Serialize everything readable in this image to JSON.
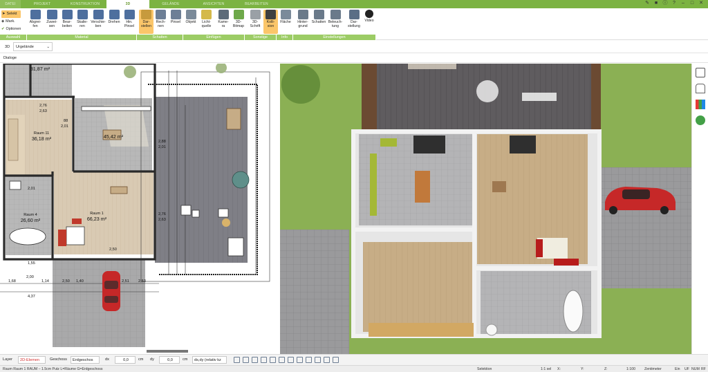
{
  "tabs": [
    "DATEI",
    "PROJEKT",
    "KONSTRUKTION",
    "3D",
    "GELÄNDE",
    "ANSICHTEN",
    "BEARBEITEN"
  ],
  "active_tab": "3D",
  "selection": {
    "select": "Selekt",
    "mark": "Mark.",
    "options": "Optionen"
  },
  "ribbon": {
    "groups": [
      "Auswahl",
      "Material",
      "Schatten",
      "Einfügen",
      "Sonstige",
      "Info",
      "Einstellungen"
    ],
    "buttons": [
      {
        "label1": "Abgrei-",
        "label2": "fen"
      },
      {
        "label1": "Zuwei-",
        "label2": "sen"
      },
      {
        "label1": "Bear-",
        "label2": "beiten"
      },
      {
        "label1": "Skalie-",
        "label2": "ren"
      },
      {
        "label1": "Verschie-",
        "label2": "ben"
      },
      {
        "label1": "Drehen",
        "label2": ""
      },
      {
        "label1": "Hin.",
        "label2": "Pinsel"
      },
      {
        "label1": "Dar-",
        "label2": "stellen"
      },
      {
        "label1": "Rech-",
        "label2": "nen"
      },
      {
        "label1": "Pinsel",
        "label2": ""
      },
      {
        "label1": "Objekt",
        "label2": ""
      },
      {
        "label1": "Licht-",
        "label2": "quelle"
      },
      {
        "label1": "Kame-",
        "label2": "ra"
      },
      {
        "label1": "3D-",
        "label2": "Bitmap"
      },
      {
        "label1": "3D-",
        "label2": "Schrift"
      },
      {
        "label1": "Kolli-",
        "label2": "sion"
      },
      {
        "label1": "Fläche",
        "label2": ""
      },
      {
        "label1": "Hinter-",
        "label2": "grund"
      },
      {
        "label1": "Schatten",
        "label2": ""
      },
      {
        "label1": "Beleuch-",
        "label2": "tung"
      },
      {
        "label1": "Dar-",
        "label2": "stellung"
      },
      {
        "label1": "Video",
        "label2": ""
      }
    ]
  },
  "view": {
    "label": "3D",
    "dropdown": "Urgelände"
  },
  "dialog": "Dialoge",
  "rooms": [
    {
      "area": "31,87 m²"
    },
    {
      "name": "Raum 11",
      "area": "36,18 m²"
    },
    {
      "name": "",
      "area": "45,42 m²"
    },
    {
      "name": "Raum 1",
      "area": "66,23 m²"
    },
    {
      "name": "Raum 4",
      "area": "26,60 m²"
    }
  ],
  "dims": [
    "88",
    "2,01",
    "2,88",
    "2,01",
    "2,76",
    "2,63",
    "2,76",
    "2,63",
    "2,01",
    "1,55",
    "2,50",
    "2,00",
    "4,37",
    "2,50",
    "1,68",
    "1,14",
    "1,40",
    "2,51",
    "2,53"
  ],
  "statusbar": {
    "layer_label": "Layer",
    "layer_value": "2D-Elemen",
    "geschoss_label": "Geschoss",
    "geschoss_value": "Erdgeschos",
    "dx_label": "dx",
    "dx_value": "0,0",
    "dy_label": "dy",
    "dy_value": "0,0",
    "unit1": "cm",
    "unit2": "cm",
    "mode": "ds,dy (relativ kz"
  },
  "footer": {
    "left": "Raum Raum 1 RAUM – 1.5cm Putz L=Räume G=Erdgeschoss",
    "selektion": "Selektion",
    "ratio": "1:1 sel",
    "x": "X:",
    "y": "Y:",
    "z": "Z:",
    "scale": "1:100",
    "unit": "Zentimeter",
    "ein": "Ein",
    "uf": "UF",
    "num": "NUM",
    "rf": "RF"
  },
  "colors": {
    "green": "#7cb342",
    "ribbon_hl": "#fbc66a",
    "grass": "#8bb054",
    "car": "#c62828"
  }
}
